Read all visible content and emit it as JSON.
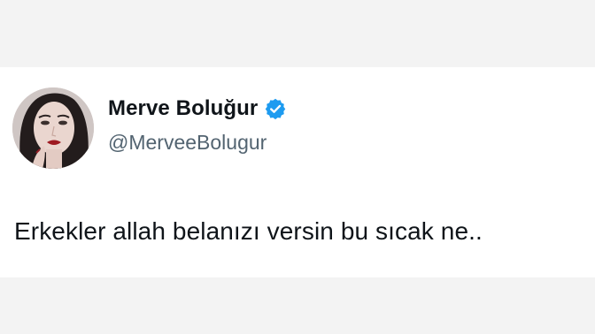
{
  "tweet": {
    "author": {
      "display_name": "Merve Boluğur",
      "handle": "@MerveeBolugur",
      "verified": true,
      "avatar": "profile-photo"
    },
    "text": "Erkekler allah belanızı versin bu sıcak ne.."
  },
  "colors": {
    "page_background": "#f3f3f3",
    "card_background": "#ffffff",
    "name_color": "#0f1419",
    "handle_color": "#536471",
    "verified_badge": "#1d9bf0"
  },
  "icons": {
    "verified": "verified-badge-icon"
  }
}
